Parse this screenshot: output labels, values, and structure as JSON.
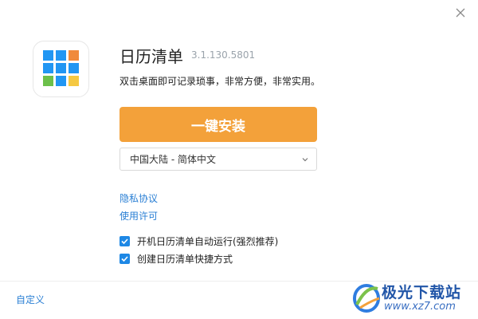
{
  "window": {
    "close_icon": "close-icon"
  },
  "app": {
    "name": "日历清单",
    "version": "3.1.130.5801",
    "description": "双击桌面即可记录琐事，非常方便，非常实用。",
    "logo_icon": "calendar-grid-logo",
    "logo_colors": [
      "#2196f3",
      "#2196f3",
      "#f08a3c",
      "#2196f3",
      "#2196f3",
      "#2196f3",
      "#6cc04a",
      "#2196f3",
      "#f5c842"
    ]
  },
  "install": {
    "label": "一键安装",
    "color": "#f3a13a"
  },
  "language": {
    "selected": "中国大陆 - 简体中文",
    "icon": "chevron-down-icon"
  },
  "links": {
    "privacy": "隐私协议",
    "license": "使用许可"
  },
  "options": [
    {
      "label": "开机日历清单自动运行(强烈推荐)",
      "checked": true
    },
    {
      "label": "创建日历清单快捷方式",
      "checked": true
    }
  ],
  "footer": {
    "custom": "自定义"
  },
  "watermark": {
    "title": "极光下载站",
    "url": "www.xz7.com"
  }
}
